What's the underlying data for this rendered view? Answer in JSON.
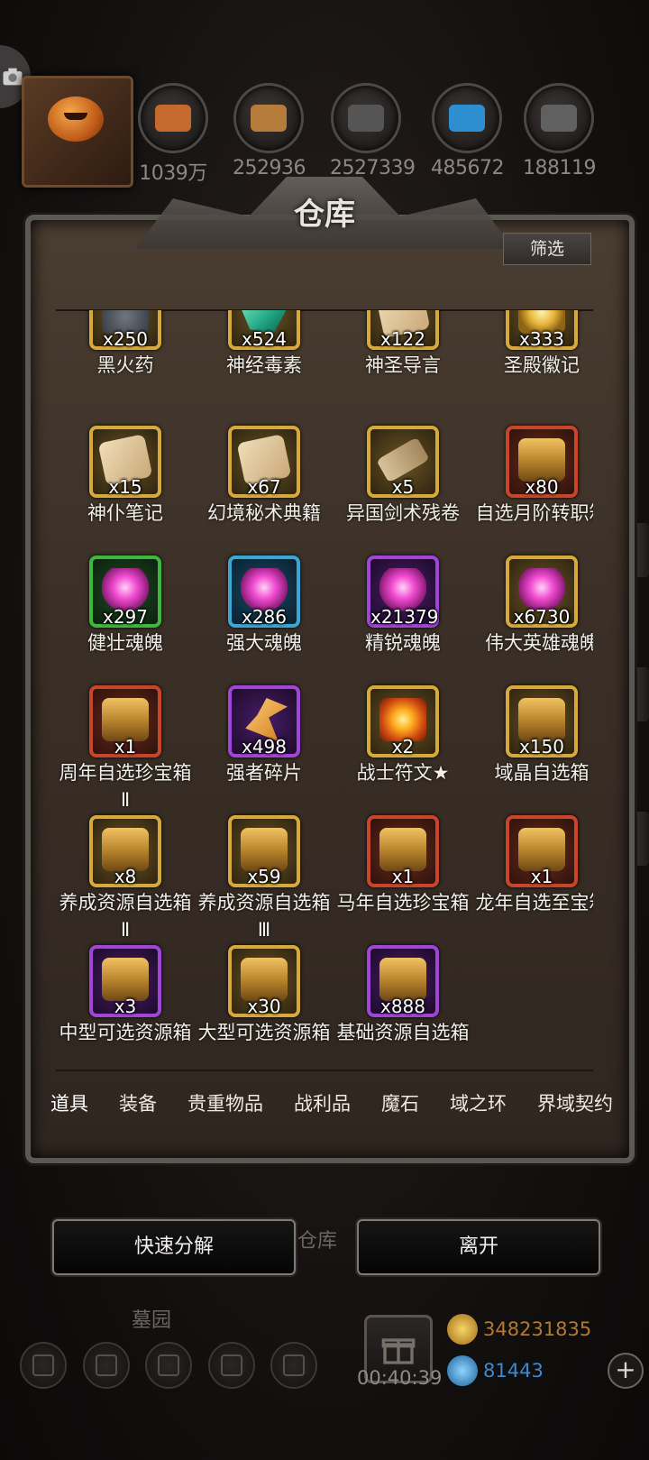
{
  "header": {
    "resources": [
      {
        "value": "1039万",
        "icon": "copper-ore-icon",
        "color": "#c56a2c"
      },
      {
        "value": "252936",
        "icon": "wood-planks-icon",
        "color": "#b57c3c"
      },
      {
        "value": "2527339",
        "icon": "stone-blocks-icon",
        "color": "#555555"
      },
      {
        "value": "485672",
        "icon": "blue-feather-icon",
        "color": "#2d8fd0"
      },
      {
        "value": "188119",
        "icon": "iron-ingot-icon",
        "color": "#606060"
      }
    ]
  },
  "warehouse": {
    "title": "仓库",
    "filter_label": "筛选",
    "items": [
      {
        "name": "黑火药",
        "count": "x250",
        "frame": "gold",
        "glyph": "rock"
      },
      {
        "name": "神经毒素",
        "count": "x524",
        "frame": "gold",
        "glyph": "crystal"
      },
      {
        "name": "神圣导言",
        "count": "x122",
        "frame": "gold",
        "glyph": "scroll"
      },
      {
        "name": "圣殿徽记",
        "count": "x333",
        "frame": "gold",
        "glyph": "seal"
      },
      {
        "name": "神仆笔记",
        "count": "x15",
        "frame": "gold",
        "glyph": "scroll"
      },
      {
        "name": "幻境秘术典籍",
        "count": "x67",
        "frame": "gold",
        "glyph": "scroll"
      },
      {
        "name": "异国剑术残卷",
        "count": "x5",
        "frame": "gold",
        "glyph": "roll"
      },
      {
        "name": "自选月阶转职箱",
        "count": "x80",
        "frame": "red",
        "glyph": "chest"
      },
      {
        "name": "健壮魂魄",
        "count": "x297",
        "frame": "green",
        "glyph": "soul"
      },
      {
        "name": "强大魂魄",
        "count": "x286",
        "frame": "blue",
        "glyph": "soul"
      },
      {
        "name": "精锐魂魄",
        "count": "x21379",
        "frame": "purple",
        "glyph": "soul"
      },
      {
        "name": "伟大英雄魂魄",
        "count": "x6730",
        "frame": "gold",
        "glyph": "soul"
      },
      {
        "name": "周年自选珍宝箱Ⅱ",
        "count": "x1",
        "frame": "red",
        "glyph": "chest"
      },
      {
        "name": "强者碎片",
        "count": "x498",
        "frame": "purple",
        "glyph": "shard"
      },
      {
        "name": "战士符文★",
        "count": "x2",
        "frame": "gold",
        "glyph": "rune"
      },
      {
        "name": "域晶自选箱",
        "count": "x150",
        "frame": "gold",
        "glyph": "chest"
      },
      {
        "name": "养成资源自选箱Ⅱ",
        "count": "x8",
        "frame": "gold",
        "glyph": "chest"
      },
      {
        "name": "养成资源自选箱Ⅲ",
        "count": "x59",
        "frame": "gold",
        "glyph": "chest"
      },
      {
        "name": "马年自选珍宝箱",
        "count": "x1",
        "frame": "red",
        "glyph": "chest"
      },
      {
        "name": "龙年自选至宝箱",
        "count": "x1",
        "frame": "red",
        "glyph": "chest"
      },
      {
        "name": "中型可选资源箱",
        "count": "x3",
        "frame": "purple",
        "glyph": "chest"
      },
      {
        "name": "大型可选资源箱",
        "count": "x30",
        "frame": "gold",
        "glyph": "chest"
      },
      {
        "name": "基础资源自选箱",
        "count": "x888",
        "frame": "purple",
        "glyph": "chest"
      }
    ],
    "tabs": [
      "道具",
      "装备",
      "贵重物品",
      "战利品",
      "魔石",
      "域之环",
      "界域契约"
    ],
    "active_tab": "道具"
  },
  "actions": {
    "decompose_label": "快速分解",
    "leave_label": "离开"
  },
  "background": {
    "warehouse_label": "仓库",
    "graveyard_label": "墓园",
    "timer": "00:40:39",
    "gold": "348231835",
    "gems": "81443"
  }
}
